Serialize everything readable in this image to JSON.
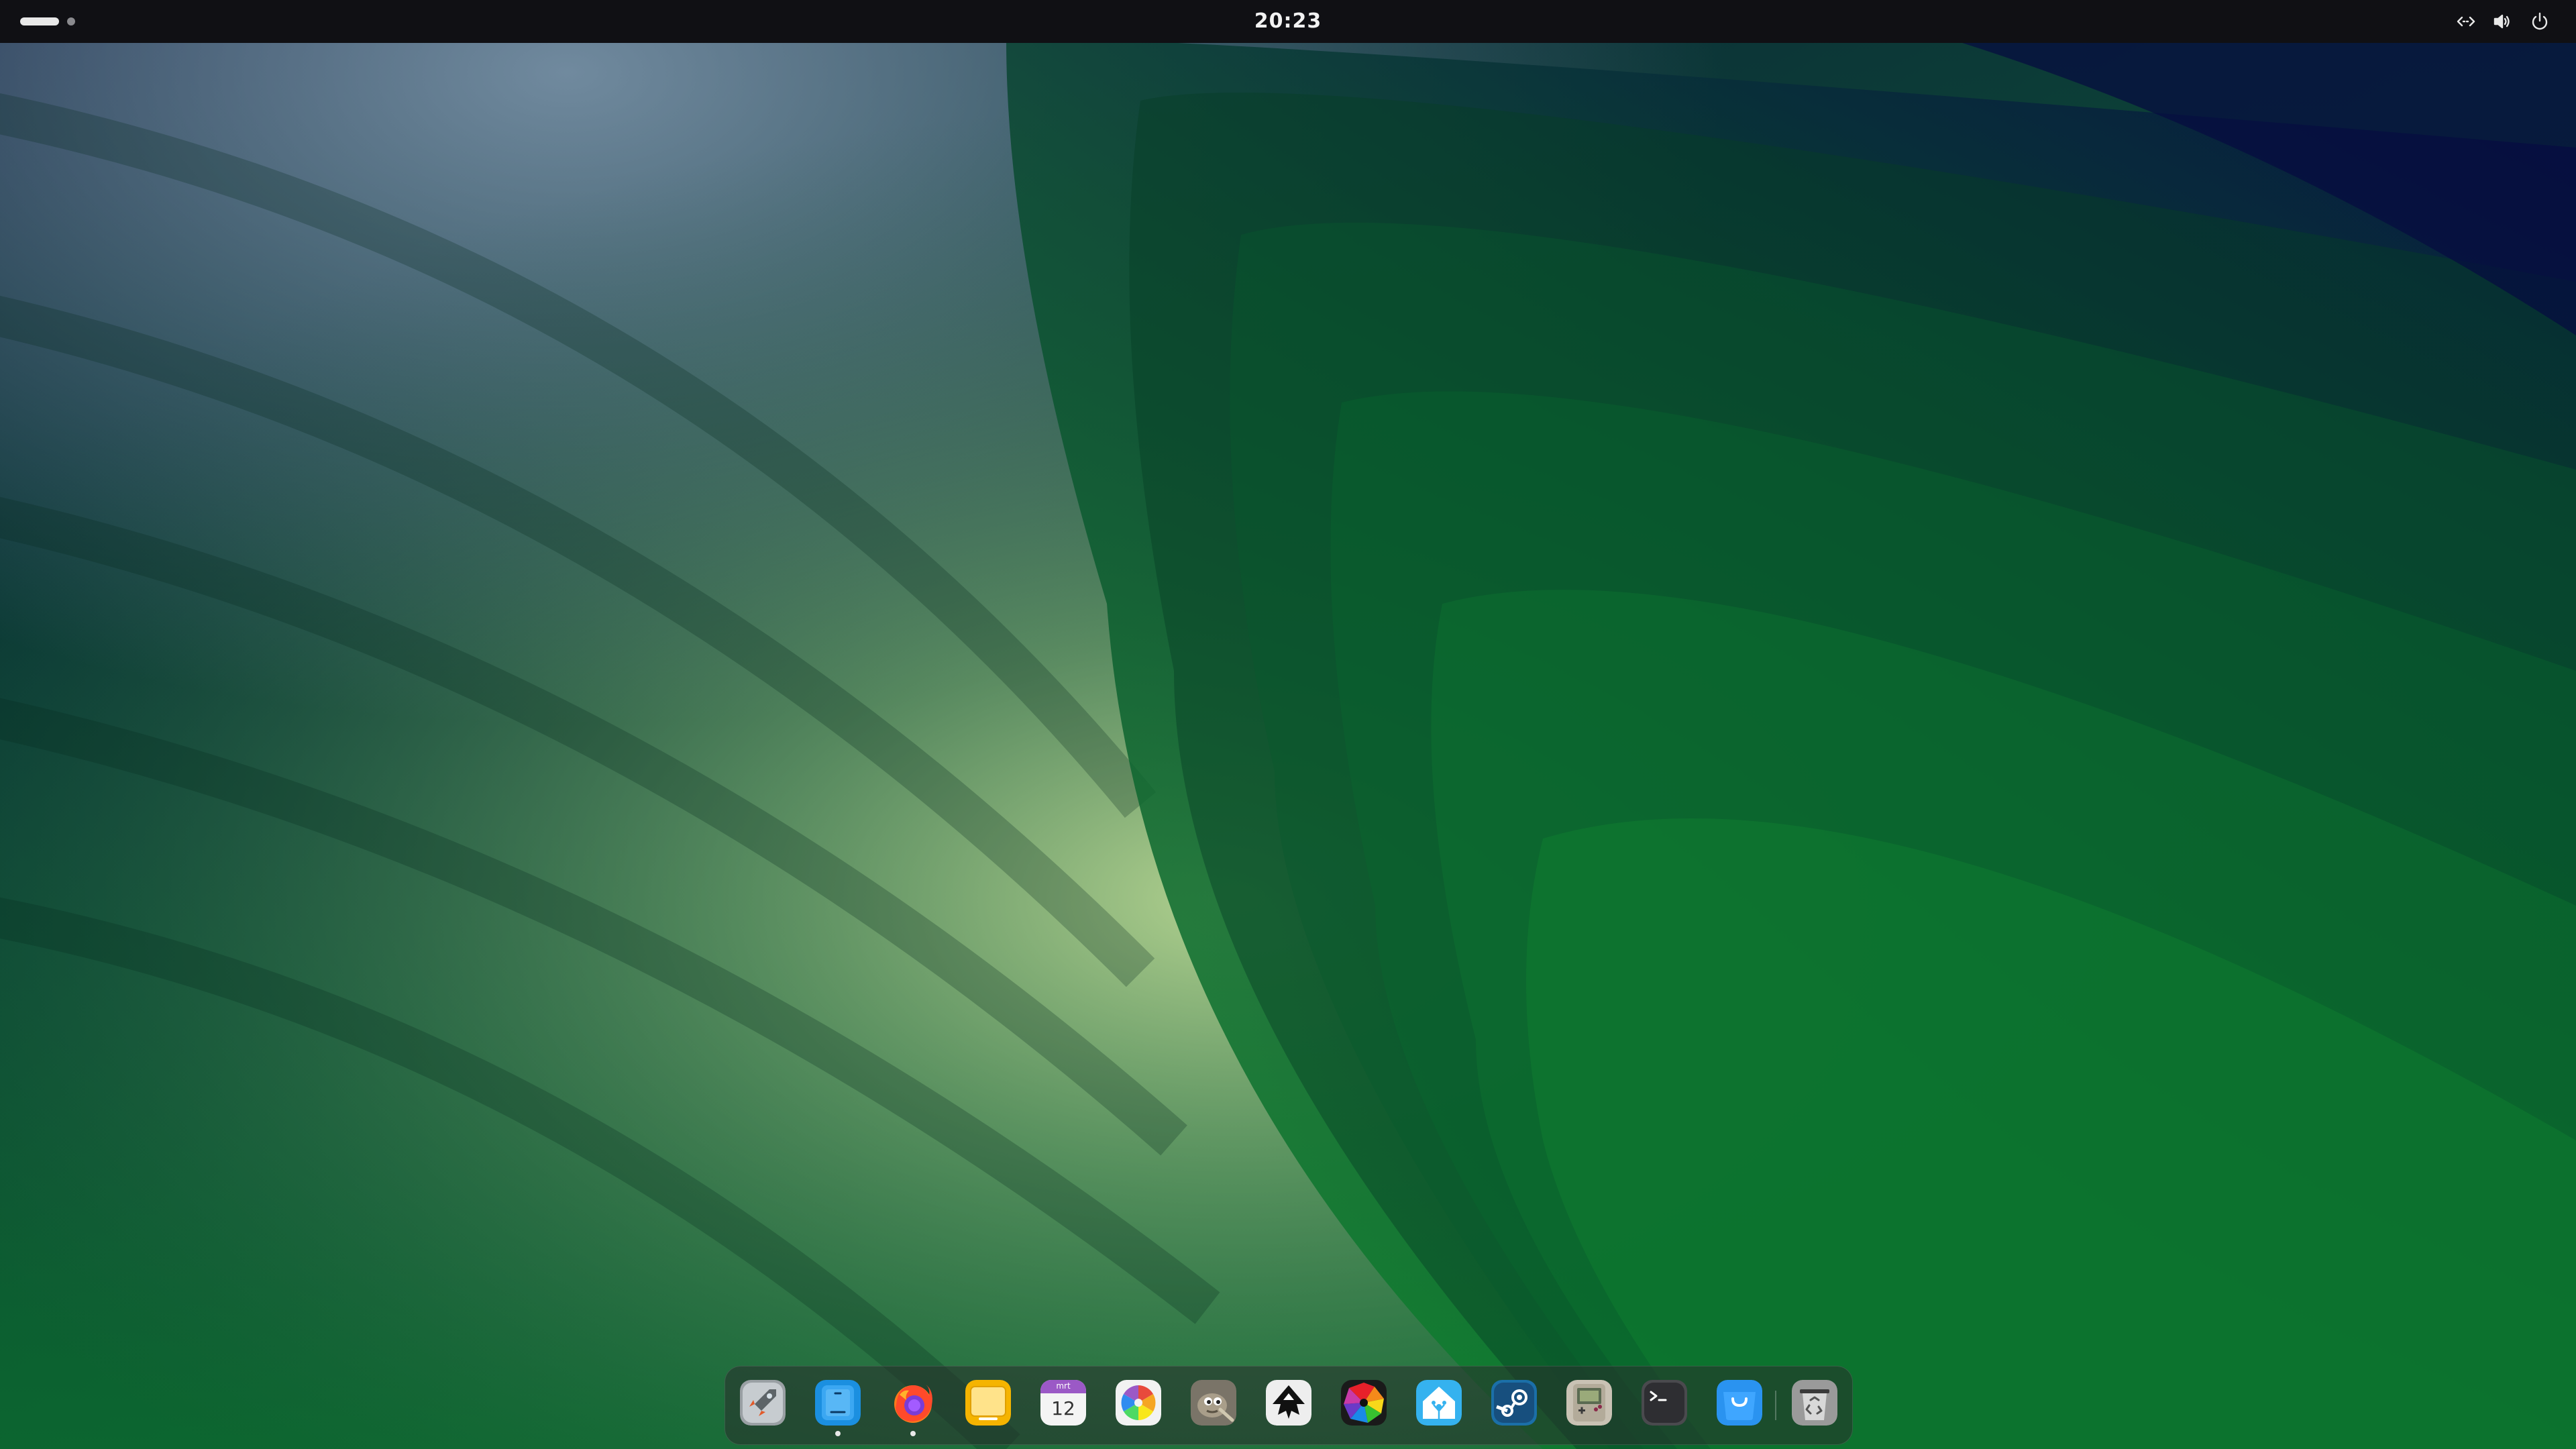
{
  "top_bar": {
    "clock": "20:23",
    "workspaces": [
      {
        "name": "workspace-1",
        "active": true
      },
      {
        "name": "workspace-2",
        "active": false
      }
    ],
    "tray_icons": [
      "network-icon",
      "volume-icon",
      "power-icon"
    ],
    "background": "#101014"
  },
  "wallpaper": {
    "colors": [
      "#061232",
      "#0b4a2c",
      "#127a32",
      "#a7cf8a",
      "#06103e"
    ]
  },
  "dock": {
    "apps": [
      {
        "name": "launchpad-icon",
        "running": false
      },
      {
        "name": "files-icon",
        "running": true
      },
      {
        "name": "firefox-icon",
        "running": true
      },
      {
        "name": "notes-icon",
        "running": false
      },
      {
        "name": "calendar-icon",
        "running": false,
        "month": "mrt",
        "day": "12"
      },
      {
        "name": "photos-icon",
        "running": false
      },
      {
        "name": "gimp-icon",
        "running": false
      },
      {
        "name": "inkscape-icon",
        "running": false
      },
      {
        "name": "darktable-icon",
        "running": false
      },
      {
        "name": "home-assistant-icon",
        "running": false
      },
      {
        "name": "steam-icon",
        "running": false
      },
      {
        "name": "gameboy-emulator-icon",
        "running": false
      },
      {
        "name": "terminal-icon",
        "running": false
      },
      {
        "name": "software-store-icon",
        "running": false
      },
      {
        "name": "trash-icon",
        "running": false
      }
    ]
  }
}
